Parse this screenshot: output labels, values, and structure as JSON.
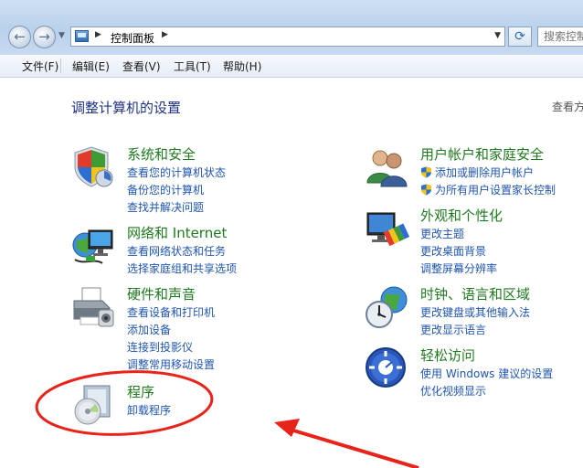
{
  "address_bar": {
    "breadcrumb": "控制面板"
  },
  "search": {
    "placeholder": "搜索控制面板"
  },
  "menu": [
    "文件(F)",
    "编辑(E)",
    "查看(V)",
    "工具(T)",
    "帮助(H)"
  ],
  "page_title": "调整计算机的设置",
  "view_by": "查看方式",
  "categories_left": [
    {
      "title": "系统和安全",
      "icon": "shield-icon",
      "links": [
        "查看您的计算机状态",
        "备份您的计算机",
        "查找并解决问题"
      ]
    },
    {
      "title": "网络和 Internet",
      "icon": "network-globe-icon",
      "links": [
        "查看网络状态和任务",
        "选择家庭组和共享选项"
      ]
    },
    {
      "title": "硬件和声音",
      "icon": "printer-icon",
      "links": [
        "查看设备和打印机",
        "添加设备",
        "连接到投影仪",
        "调整常用移动设置"
      ]
    },
    {
      "title": "程序",
      "icon": "programs-disc-icon",
      "links": [
        "卸载程序"
      ]
    }
  ],
  "categories_right": [
    {
      "title": "用户帐户和家庭安全",
      "icon": "users-icon",
      "links": [
        "添加或删除用户帐户",
        "为所有用户设置家长控制"
      ]
    },
    {
      "title": "外观和个性化",
      "icon": "monitor-palette-icon",
      "links": [
        "更改主题",
        "更改桌面背景",
        "调整屏幕分辨率"
      ]
    },
    {
      "title": "时钟、语言和区域",
      "icon": "clock-globe-icon",
      "links": [
        "更改键盘或其他输入法",
        "更改显示语言"
      ]
    },
    {
      "title": "轻松访问",
      "icon": "ease-of-access-icon",
      "links": [
        "使用 Windows 建议的设置",
        "优化视频显示"
      ]
    }
  ],
  "annotation_color": "#e8231a"
}
